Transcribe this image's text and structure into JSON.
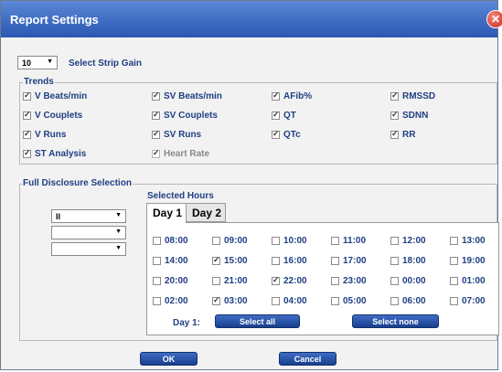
{
  "window": {
    "title": "Report Settings"
  },
  "strip_gain": {
    "value": "10",
    "label": "Select Strip Gain"
  },
  "trends": {
    "heading": "Trends",
    "items": [
      {
        "label": "V Beats/min",
        "checked": true
      },
      {
        "label": "SV Beats/min",
        "checked": true
      },
      {
        "label": "AFib%",
        "checked": true
      },
      {
        "label": "RMSSD",
        "checked": true
      },
      {
        "label": "V Couplets",
        "checked": true
      },
      {
        "label": "SV Couplets",
        "checked": true
      },
      {
        "label": "QT",
        "checked": true
      },
      {
        "label": "SDNN",
        "checked": true
      },
      {
        "label": "V Runs",
        "checked": true
      },
      {
        "label": "SV Runs",
        "checked": true
      },
      {
        "label": "QTc",
        "checked": true
      },
      {
        "label": "RR",
        "checked": true
      },
      {
        "label": "ST Analysis",
        "checked": true
      },
      {
        "label": "Heart Rate",
        "checked": true,
        "disabled": true
      }
    ]
  },
  "full_disclosure": {
    "heading": "Full Disclosure Selection",
    "leads": [
      "II",
      "",
      ""
    ],
    "selected_hours_label": "Selected Hours",
    "tabs": [
      {
        "label": "Day 1"
      },
      {
        "label": "Day 2"
      }
    ],
    "hours": [
      {
        "label": "08:00",
        "checked": false
      },
      {
        "label": "09:00",
        "checked": false
      },
      {
        "label": "10:00",
        "checked": false
      },
      {
        "label": "11:00",
        "checked": false
      },
      {
        "label": "12:00",
        "checked": false
      },
      {
        "label": "13:00",
        "checked": false
      },
      {
        "label": "14:00",
        "checked": false
      },
      {
        "label": "15:00",
        "checked": true
      },
      {
        "label": "16:00",
        "checked": false
      },
      {
        "label": "17:00",
        "checked": false
      },
      {
        "label": "18:00",
        "checked": false
      },
      {
        "label": "19:00",
        "checked": false
      },
      {
        "label": "20:00",
        "checked": false
      },
      {
        "label": "21:00",
        "checked": false
      },
      {
        "label": "22:00",
        "checked": true
      },
      {
        "label": "23:00",
        "checked": false
      },
      {
        "label": "00:00",
        "checked": false
      },
      {
        "label": "01:00",
        "checked": false
      },
      {
        "label": "02:00",
        "checked": false
      },
      {
        "label": "03:00",
        "checked": true
      },
      {
        "label": "04:00",
        "checked": false
      },
      {
        "label": "05:00",
        "checked": false
      },
      {
        "label": "06:00",
        "checked": false
      },
      {
        "label": "07:00",
        "checked": false
      }
    ],
    "day_label": "Day 1:",
    "select_all_label": "Select all",
    "select_none_label": "Select none"
  },
  "footer": {
    "ok_label": "OK",
    "cancel_label": "Cancel"
  },
  "colors": {
    "title_bar": "#2a57b2",
    "label_text": "#1f3f82",
    "button": "#1f4b9e",
    "close": "#c7261a"
  }
}
